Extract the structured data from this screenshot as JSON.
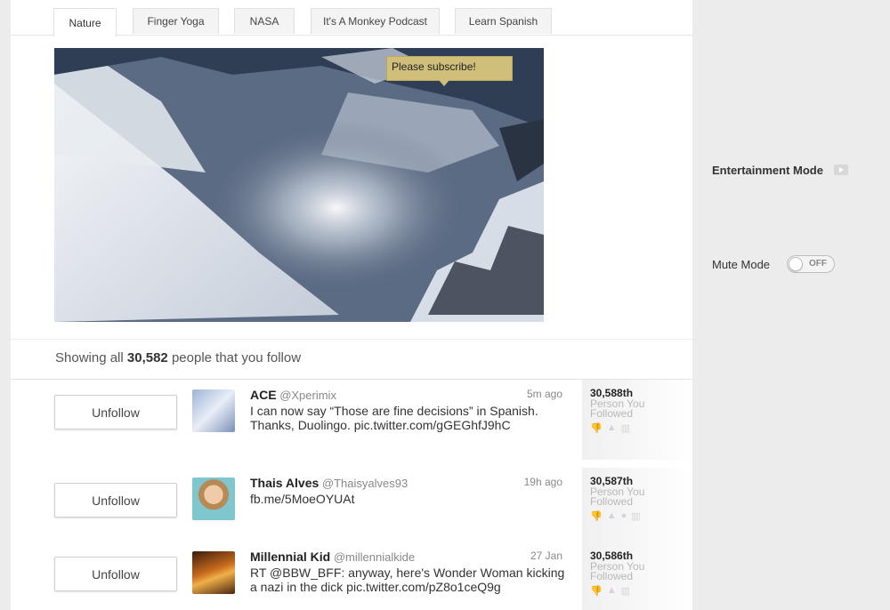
{
  "tabs": [
    {
      "label": "Nature",
      "active": true
    },
    {
      "label": "Finger Yoga",
      "active": false
    },
    {
      "label": "NASA",
      "active": false
    },
    {
      "label": "It's A Monkey Podcast",
      "active": false
    },
    {
      "label": "Learn Spanish",
      "active": false
    }
  ],
  "video": {
    "tooltip": "Please subscribe!"
  },
  "summary": {
    "prefix": "Showing all",
    "count": "30,582",
    "suffix": "people that you follow"
  },
  "rows": [
    {
      "button": "Unfollow",
      "name": "ACE",
      "handle": "@Xperimix",
      "time": "5m ago",
      "tweet": "I can now say “Those are fine decisions” in Spanish. Thanks, Duolingo. pic.twitter.com/gGEGhfJ9hC",
      "rank": "30,588th",
      "rank_sub": "Person You Followed"
    },
    {
      "button": "Unfollow",
      "name": "Thais Alves",
      "handle": "@Thaisyalves93",
      "time": "19h ago",
      "tweet": "fb.me/5MoeOYUAt",
      "rank": "30,587th",
      "rank_sub": "Person You Followed"
    },
    {
      "button": "Unfollow",
      "name": "Millennial Kid",
      "handle": "@millennialkide",
      "time": "27 Jan",
      "tweet": "RT @BBW_BFF: anyway, here's Wonder Woman kicking a nazi in the dick pic.twitter.com/pZ8o1ceQ9g",
      "rank": "30,586th",
      "rank_sub": "Person You Followed"
    }
  ],
  "sidebar": {
    "entertainment_label": "Entertainment Mode",
    "mute_label": "Mute Mode",
    "mute_state": "OFF"
  },
  "icons": {
    "play": "play-icon",
    "dislike": "thumbs-down-icon",
    "retweet": "arrow-up-icon",
    "reply": "speech-bubble-icon",
    "stats": "bar-chart-icon"
  },
  "colors": {
    "tooltip": "#cfbf7a",
    "panel_bg": "#ececec"
  }
}
